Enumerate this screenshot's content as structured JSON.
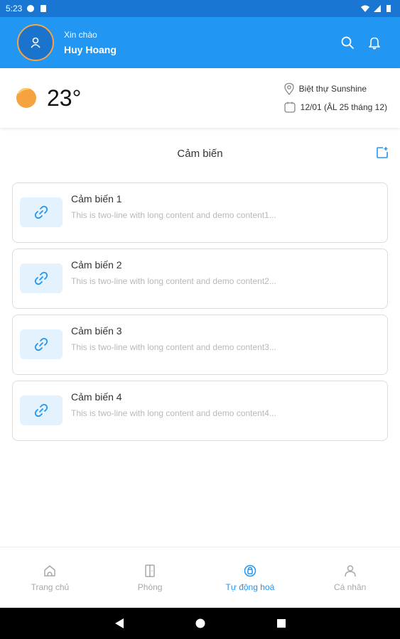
{
  "status_bar": {
    "time": "5:23"
  },
  "header": {
    "greeting": "Xin chào",
    "user_name": "Huy Hoang"
  },
  "weather": {
    "temperature": "23°",
    "location": "Biệt thự Sunshine",
    "date": "12/01 (ÂL 25 tháng 12)"
  },
  "section": {
    "title": "Cảm biến"
  },
  "cards": [
    {
      "title": "Cảm biến 1",
      "subtitle": "This is two-line with long content and demo content1..."
    },
    {
      "title": "Cảm biến 2",
      "subtitle": "This is two-line with long content and demo content2..."
    },
    {
      "title": "Cảm biến 3",
      "subtitle": "This is two-line with long content and demo content3..."
    },
    {
      "title": "Cảm biến 4",
      "subtitle": "This is two-line with long content and demo content4..."
    }
  ],
  "bottom_nav": {
    "home": "Trang chủ",
    "rooms": "Phòng",
    "automation": "Tự động hoá",
    "profile": "Cá nhân",
    "active": "automation"
  },
  "colors": {
    "primary": "#2196f3",
    "status_bar": "#1976d2",
    "card_icon_bg": "#e3f2fd",
    "avatar_ring": "#f3a548",
    "sun": "#f4a340"
  }
}
